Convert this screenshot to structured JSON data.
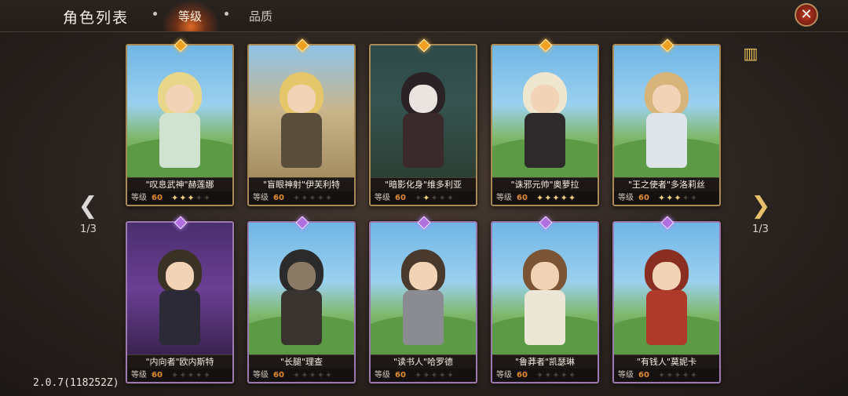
{
  "header": {
    "title": "角色列表",
    "tabs": [
      {
        "label": "等级",
        "active": true
      },
      {
        "label": "品质",
        "active": false
      }
    ]
  },
  "icons": {
    "close": "close-icon",
    "grid": "grid-toggle-icon",
    "prev": "arrow-left-icon",
    "next": "arrow-right-icon"
  },
  "pagination": {
    "left": "1/3",
    "right": "1/3"
  },
  "level_label": "等级",
  "cards": [
    {
      "name": "\"叹息武神\"赫莲娜",
      "level": "60",
      "stars": 3,
      "rarity": "gold"
    },
    {
      "name": "\"盲眼神射\"伊芙利特",
      "level": "60",
      "stars": 0,
      "rarity": "gold"
    },
    {
      "name": "\"暗影化身\"维多利亚",
      "level": "60",
      "stars": 1,
      "rarity": "gold"
    },
    {
      "name": "\"诛邪元帅\"奥萝拉",
      "level": "60",
      "stars": 5,
      "rarity": "gold"
    },
    {
      "name": "\"王之使者\"多洛莉丝",
      "level": "60",
      "stars": 3,
      "rarity": "gold"
    },
    {
      "name": "\"内向者\"欧内斯特",
      "level": "60",
      "stars": 0,
      "rarity": "violet"
    },
    {
      "name": "\"长腿\"理查",
      "level": "60",
      "stars": 0,
      "rarity": "violet"
    },
    {
      "name": "\"读书人\"哈罗德",
      "level": "60",
      "stars": 0,
      "rarity": "violet"
    },
    {
      "name": "\"鲁莽者\"凯瑟琳",
      "level": "60",
      "stars": 0,
      "rarity": "violet"
    },
    {
      "name": "\"有钱人\"莫妮卡",
      "level": "60",
      "stars": 0,
      "rarity": "violet"
    }
  ],
  "version": "2.0.7(118252Z)"
}
